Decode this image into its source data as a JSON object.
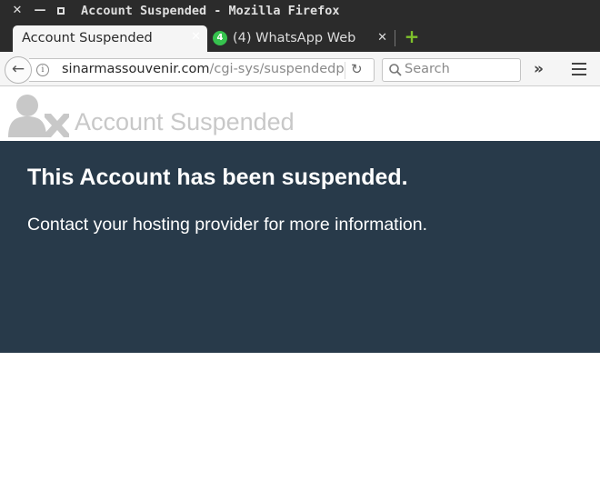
{
  "window": {
    "title": "Account Suspended - Mozilla Firefox",
    "close_glyph": "✕",
    "minimize_glyph": "—"
  },
  "tabs": [
    {
      "label": "Account Suspended",
      "active": true,
      "close_glyph": "✕"
    },
    {
      "label": "(4) WhatsApp Web",
      "active": false,
      "badge": "4",
      "close_glyph": "✕",
      "icon": "whatsapp-icon"
    }
  ],
  "newtab_glyph": "+",
  "navbar": {
    "back_glyph": "←",
    "info_glyph": "i",
    "url_host": "sinarmassouvenir.com",
    "url_path": "/cgi-sys/suspendedpage.cgi",
    "reload_glyph": "↻",
    "search_placeholder": "Search",
    "overflow_glyph": "»"
  },
  "page": {
    "title": "Account Suspended",
    "heading": "This Account has been suspended.",
    "message": "Contact your hosting provider for more information."
  },
  "colors": {
    "panel_bg": "#283a4a",
    "title_gray": "#c8c8c8",
    "chrome_dark": "#2b2b2b",
    "newtab_green": "#7ec12b",
    "whatsapp_green": "#36c24e"
  }
}
